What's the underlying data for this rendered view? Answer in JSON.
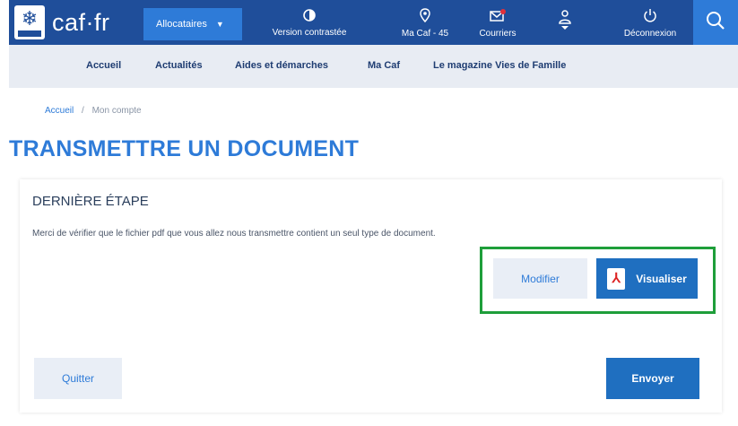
{
  "header": {
    "logo_text": "caf·fr",
    "dropdown_label": "Allocataires",
    "nav": [
      {
        "label": "Version contrastée",
        "icon": "eye-icon"
      },
      {
        "label": "Ma Caf - 45",
        "icon": "location-pin-icon"
      },
      {
        "label": "Courriers",
        "icon": "mail-icon"
      },
      {
        "label": "",
        "icon": "user-icon"
      },
      {
        "label": "Déconnexion",
        "icon": "power-icon"
      }
    ],
    "search_icon": "search-icon",
    "colors": {
      "bar": "#1f4e9a",
      "accent": "#2e7bd8"
    }
  },
  "subnav": {
    "items": [
      "Accueil",
      "Actualités",
      "Aides et démarches",
      "Ma Caf",
      "Le magazine Vies de Famille"
    ]
  },
  "breadcrumb": {
    "home": "Accueil",
    "separator": "/",
    "current": "Mon compte"
  },
  "page_title": "TRANSMETTRE UN DOCUMENT",
  "step": {
    "title": "DERNIÈRE ÉTAPE",
    "instruction": "Merci de vérifier que le fichier pdf que vous allez nous transmettre contient un seul type de document.",
    "buttons": {
      "modify": "Modifier",
      "preview": "Visualiser",
      "quit": "Quitter",
      "send": "Envoyer"
    },
    "highlight_color": "#1e9e3a"
  }
}
